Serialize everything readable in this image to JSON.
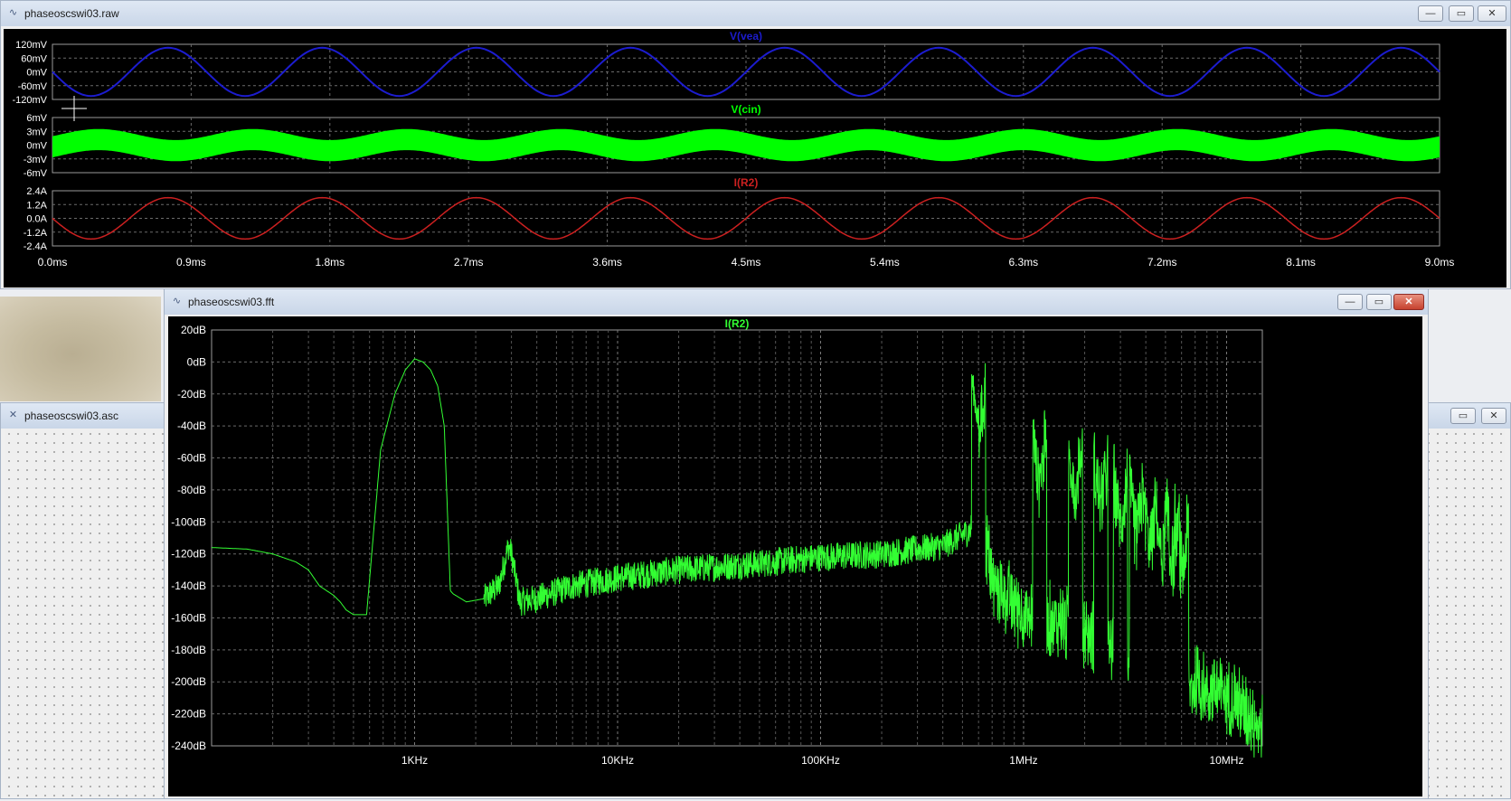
{
  "raw_window": {
    "title": "phaseoscswi03.raw",
    "icon": "waveform-icon",
    "buttons": {
      "minimize": "—",
      "maximize": "▭",
      "close": "✕"
    },
    "panes": [
      {
        "trace": "V(vea)",
        "color": "#1c1ccf",
        "ticks": [
          "120mV",
          "60mV",
          "0mV",
          "-60mV",
          "-120mV"
        ]
      },
      {
        "trace": "V(cin)",
        "color": "#00ff00",
        "ticks": [
          "6mV",
          "3mV",
          "0mV",
          "-3mV",
          "-6mV"
        ]
      },
      {
        "trace": "I(R2)",
        "color": "#cc2020",
        "ticks": [
          "2.4A",
          "1.2A",
          "0.0A",
          "-1.2A",
          "-2.4A"
        ]
      }
    ],
    "time_ticks": [
      "0.0ms",
      "0.9ms",
      "1.8ms",
      "2.7ms",
      "3.6ms",
      "4.5ms",
      "5.4ms",
      "6.3ms",
      "7.2ms",
      "8.1ms",
      "9.0ms"
    ]
  },
  "asc_window": {
    "title": "phaseoscswi03.asc",
    "icon": "schematic-icon",
    "buttons": {
      "maximize": "▭",
      "close": "✕"
    }
  },
  "fft_window": {
    "title": "phaseoscswi03.fft",
    "icon": "waveform-icon",
    "buttons": {
      "minimize": "—",
      "maximize": "▭",
      "close": "✕"
    }
  },
  "chart_data": [
    {
      "type": "line",
      "x_unit": "ms",
      "xlim": [
        0,
        9.0
      ],
      "x": [
        0.0,
        0.9,
        1.8,
        2.7,
        3.6,
        4.5,
        5.4,
        6.3,
        7.2,
        8.1,
        9.0
      ],
      "series": [
        {
          "name": "V(vea)",
          "shape": "sine",
          "period_ms": 1.0,
          "amplitude": 105,
          "unit": "mV",
          "ylim": [
            -120,
            120
          ]
        },
        {
          "name": "V(cin)",
          "shape": "sine band",
          "period_ms": 1.0,
          "amplitude": 1.2,
          "band_halfwidth": 2.3,
          "unit": "mV",
          "ylim": [
            -6,
            6
          ]
        },
        {
          "name": "I(R2)",
          "shape": "sine",
          "period_ms": 1.0,
          "amplitude": 1.8,
          "unit": "A",
          "ylim": [
            -2.4,
            2.4
          ]
        }
      ],
      "grid": true
    },
    {
      "type": "line",
      "title": "I(R2)",
      "xscale": "log",
      "xlim_hz": [
        100,
        15000000
      ],
      "ylim_db": [
        -240,
        20
      ],
      "yticks": [
        "20dB",
        "0dB",
        "-20dB",
        "-40dB",
        "-60dB",
        "-80dB",
        "-100dB",
        "-120dB",
        "-140dB",
        "-160dB",
        "-180dB",
        "-200dB",
        "-220dB",
        "-240dB"
      ],
      "xticks": [
        "1KHz",
        "10KHz",
        "100KHz",
        "1MHz",
        "10MHz"
      ],
      "xtick_values": [
        1000,
        10000,
        100000,
        1000000,
        10000000
      ],
      "color": "#33ff33",
      "envelope": {
        "freq": [
          100,
          150,
          200,
          260,
          300,
          340,
          400,
          430,
          460,
          500,
          580,
          680,
          800,
          900,
          1000,
          1100,
          1200,
          1300,
          1400,
          1500,
          1550,
          1800,
          2200,
          2600,
          2900,
          3000,
          3300,
          4000,
          6000,
          10000,
          20000,
          50000,
          100000,
          200000,
          400000,
          550000,
          600000,
          650000,
          700000,
          1000000,
          2000000,
          5000000,
          10000000,
          15000000
        ],
        "db": [
          -116,
          -117,
          -120,
          -125,
          -130,
          -140,
          -146,
          -150,
          -155,
          -158,
          -158,
          -55,
          -20,
          -5,
          2,
          0,
          -5,
          -15,
          -40,
          -143,
          -145,
          -150,
          -148,
          -140,
          -115,
          -120,
          -150,
          -148,
          -140,
          -135,
          -130,
          -126,
          -122,
          -120,
          -115,
          -105,
          -40,
          -105,
          -130,
          -150,
          -160,
          -190,
          -200,
          -220
        ]
      },
      "spikes": [
        {
          "freq": 600000,
          "db": -40
        },
        {
          "freq": 1200000,
          "db": -68
        },
        {
          "freq": 1800000,
          "db": -75
        },
        {
          "freq": 2400000,
          "db": -85
        },
        {
          "freq": 3000000,
          "db": -95
        },
        {
          "freq": 3600000,
          "db": -103
        },
        {
          "freq": 4200000,
          "db": -108
        },
        {
          "freq": 4800000,
          "db": -115
        },
        {
          "freq": 5400000,
          "db": -120
        },
        {
          "freq": 6000000,
          "db": -124
        }
      ],
      "grid": true
    }
  ]
}
